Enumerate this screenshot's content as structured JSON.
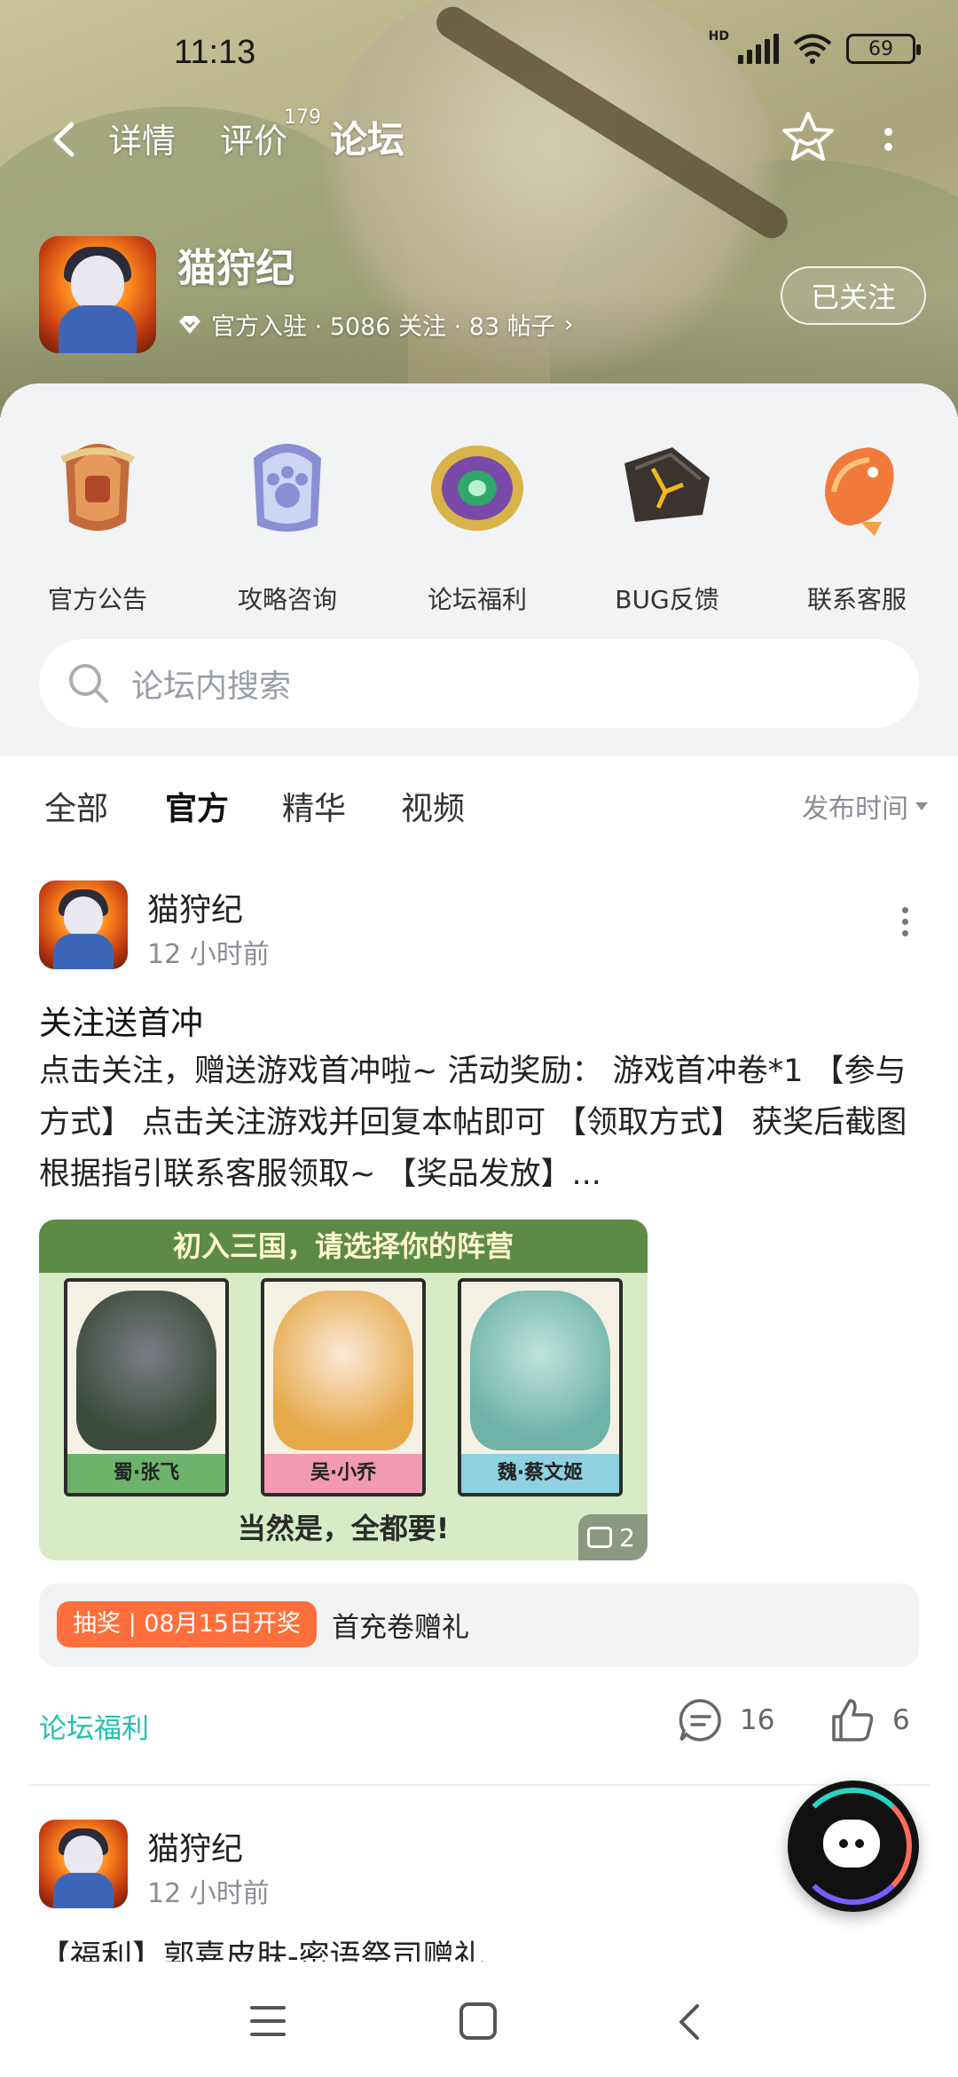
{
  "status_bar": {
    "time": "11:13",
    "network": "HD",
    "battery": "69"
  },
  "nav": {
    "tabs": [
      {
        "label": "详情"
      },
      {
        "label": "评价",
        "count": "179"
      },
      {
        "label": "论坛"
      }
    ],
    "active_tab": "论坛"
  },
  "game": {
    "name": "猫狩纪",
    "meta": "官方入驻 · 5086 关注 · 83 帖子",
    "follow_label": "已关注"
  },
  "categories": [
    {
      "label": "官方公告",
      "icon": "announcement-icon"
    },
    {
      "label": "攻略咨询",
      "icon": "guide-icon"
    },
    {
      "label": "论坛福利",
      "icon": "welfare-icon"
    },
    {
      "label": "BUG反馈",
      "icon": "bug-report-icon"
    },
    {
      "label": "联系客服",
      "icon": "customer-service-icon"
    }
  ],
  "search": {
    "placeholder": "论坛内搜索"
  },
  "filters": {
    "tabs": [
      "全部",
      "官方",
      "精华",
      "视频"
    ],
    "active": "官方",
    "sort_label": "发布时间"
  },
  "posts": [
    {
      "author": "猫狩纪",
      "time": "12 小时前",
      "title": "关注送首冲",
      "body": "点击关注，赠送游戏首冲啦~ 活动奖励： 游戏首冲卷*1 【参与方式】 点击关注游戏并回复本帖即可 【领取方式】 获奖后截图根据指引联系客服领取~ 【奖品发放】...",
      "image": {
        "header": "初入三国，请选择你的阵营",
        "cards": [
          "蜀·张飞",
          "吴·小乔",
          "魏·蔡文姬"
        ],
        "footer": "当然是，全都要!",
        "count": "2"
      },
      "lottery_tag": "抽奖 | 08月15日开奖",
      "lottery_text": "首充卷赠礼",
      "forum_tag": "论坛福利",
      "comments": "16",
      "likes": "6"
    },
    {
      "author": "猫狩纪",
      "time": "12 小时前",
      "body": "【福利】郭嘉皮肤-密语祭司赠礼"
    }
  ],
  "colors": {
    "accent": "#2ad3c4",
    "lottery": "#ff6f3c",
    "tag_text": "#22bfae"
  }
}
